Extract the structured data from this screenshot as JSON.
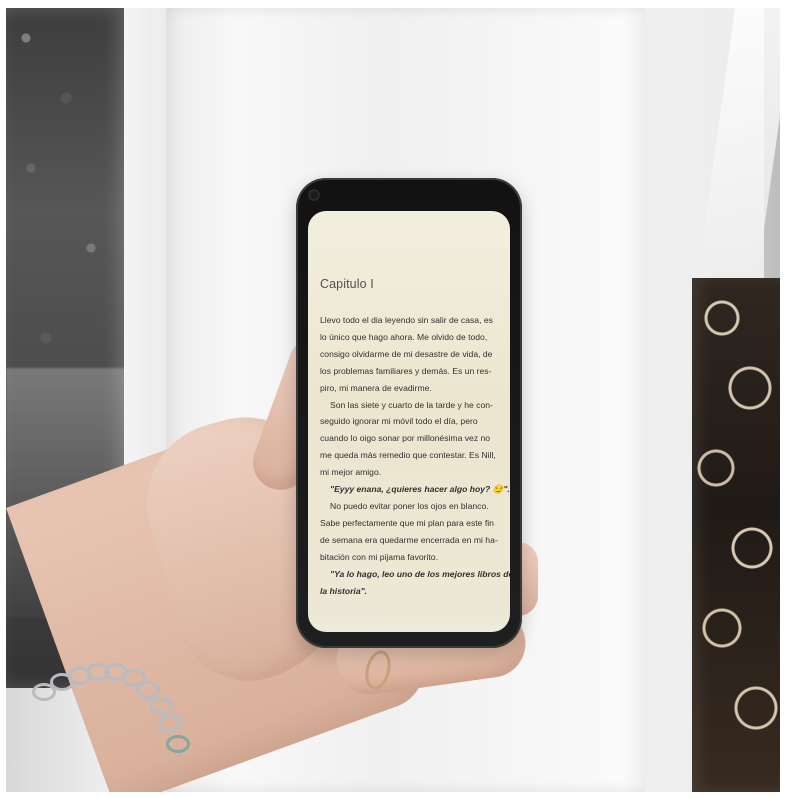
{
  "reader": {
    "chapter_title": "Capitulo I",
    "lines": [
      "Llevo todo el dia leyendo sin salir de casa, es",
      "lo único que hago ahora. Me olvido de todo,",
      "consigo olvidarme de mi desastre de vida, de",
      "los problemas familiares y demás. Es un res-",
      "piro, mi manera de evadirme.",
      "Son las siete y cuarto de la tarde y he con-",
      "seguido ignorar mi móvil todo el día, pero",
      "cuando lo oigo sonar por millonésima vez no",
      "me queda más remedio que contestar. Es Nill,",
      "mi mejor amigo.",
      "\"Eyyy enana, ¿quieres hacer algo hoy? 😏\".",
      "No puedo evitar poner los ojos en blanco.",
      "Sabe perfectamente que mi plan para este fin",
      "de semana era quedarme encerrada en mi ha-",
      "bitación con mi pijama favorito.",
      "\"Ya lo hago, leo uno de los mejores libros de",
      "la historia\"."
    ]
  }
}
